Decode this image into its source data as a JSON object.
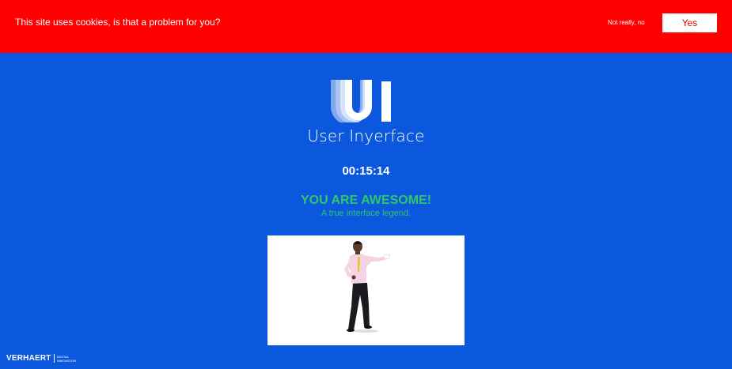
{
  "cookie_banner": {
    "message": "This site uses cookies, is that a problem for you?",
    "decline_label": "Not really, no",
    "accept_label": "Yes"
  },
  "logo": {
    "mark_text": "UI",
    "title": "User Inyerface"
  },
  "timer": {
    "value": "00:15:14"
  },
  "result": {
    "heading": "YOU ARE AWESOME!",
    "subheading": "A true interface legend."
  },
  "celebration_image": {
    "icon": "dancing-man-image"
  },
  "footer": {
    "brand_name": "VERHAERT",
    "tagline_line1": "DIGITAL",
    "tagline_line2": "INNOVATION"
  },
  "colors": {
    "background": "#0b58de",
    "cookie_bar": "#ff0000",
    "success": "#2ec866",
    "accept_text": "#e00000"
  }
}
